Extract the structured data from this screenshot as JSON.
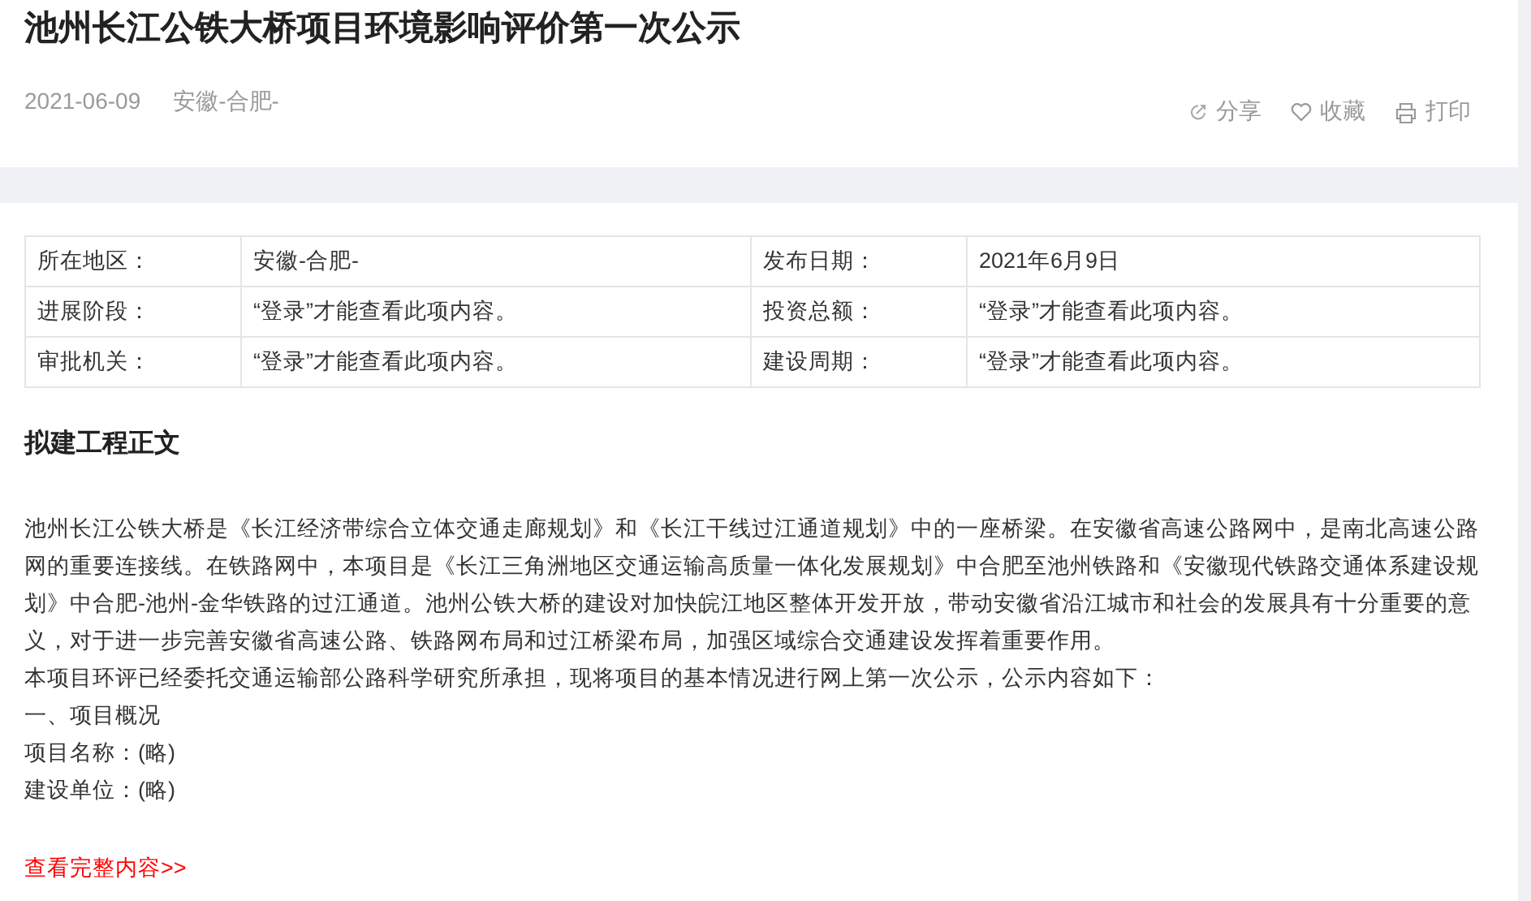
{
  "title": "池州长江公铁大桥项目环境影响评价第一次公示",
  "meta": {
    "date": "2021-06-09",
    "region": "安徽-合肥-"
  },
  "actions": [
    {
      "kind": "share",
      "label": "分享"
    },
    {
      "kind": "favorite",
      "label": "收藏"
    },
    {
      "kind": "print",
      "label": "打印"
    }
  ],
  "info_table": {
    "rows": [
      [
        {
          "label": "所在地区：",
          "value": "安徽-合肥-"
        },
        {
          "label": "发布日期：",
          "value": "2021年6月9日"
        }
      ],
      [
        {
          "label": "进展阶段：",
          "value": "“登录”才能查看此项内容。"
        },
        {
          "label": "投资总额：",
          "value": "“登录”才能查看此项内容。"
        }
      ],
      [
        {
          "label": "审批机关：",
          "value": "“登录”才能查看此项内容。"
        },
        {
          "label": "建设周期：",
          "value": "“登录”才能查看此项内容。"
        }
      ]
    ]
  },
  "body": {
    "heading": "拟建工程正文",
    "paragraphs": [
      "池州长江公铁大桥是《长江经济带综合立体交通走廊规划》和《长江干线过江通道规划》中的一座桥梁。在安徽省高速公路网中，是南北高速公路网的重要连接线。在铁路网中，本项目是《长江三角洲地区交通运输高质量一体化发展规划》中合肥至池州铁路和《安徽现代铁路交通体系建设规划》中合肥-池州-金华铁路的过江通道。池州公铁大桥的建设对加快皖江地区整体开发开放，带动安徽省沿江城市和社会的发展具有十分重要的意义，对于进一步完善安徽省高速公路、铁路网布局和过江桥梁布局，加强区域综合交通建设发挥着重要作用。",
      "本项目环评已经委托交通运输部公路科学研究所承担，现将项目的基本情况进行网上第一次公示，公示内容如下：",
      "一、项目概况",
      "项目名称：(略)",
      "建设单位：(略)"
    ]
  },
  "more_link": "查看完整内容>>"
}
